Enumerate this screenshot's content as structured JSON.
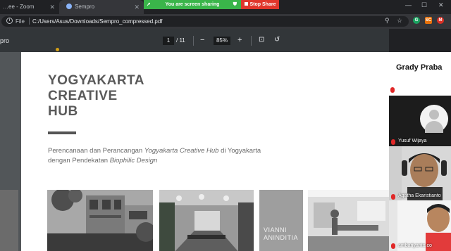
{
  "browser": {
    "tabs": [
      {
        "title": "…ee - Zoom"
      },
      {
        "title": "Sempro"
      }
    ],
    "screen_share": {
      "status_text": "You are screen sharing",
      "stop_label": "Stop Share"
    },
    "address": {
      "scheme_label": "File",
      "url": "C:/Users/Asus/Downloads/Sempro_compressed.pdf"
    },
    "extensions": [
      "G",
      "SC",
      "M"
    ]
  },
  "pdf_toolbar": {
    "doc_name": "pro",
    "current_page": "1",
    "total_pages": "/ 11",
    "zoom": "85%"
  },
  "document": {
    "title_lines": [
      "YOGYAKARTA",
      "CREATIVE",
      "HUB"
    ],
    "subtitle_1a": "Perencanaan dan Perancangan ",
    "subtitle_1b": "Yogyakarta Creative Hub",
    "subtitle_1c": " di Yogyakarta",
    "subtitle_2a": "dengan Pendekatan ",
    "subtitle_2b": "Biophilic Design",
    "photo_caption_1": "VIANNI",
    "photo_caption_2": "ANINDITIA"
  },
  "zoom": {
    "speaker": "Grady Praba",
    "participants": [
      {
        "name": "Yusuf Wijaya"
      },
      {
        "name": "Agatha Ekaristianto"
      },
      {
        "name": "ambariyanto.co"
      }
    ]
  },
  "colors": {
    "share_green": "#3ab54a",
    "stop_red": "#e0362b",
    "mic_red": "#e02828"
  }
}
